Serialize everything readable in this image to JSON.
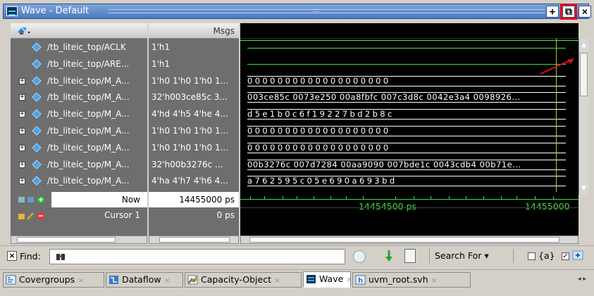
{
  "window": {
    "title": "Wave - Default",
    "buttons": {
      "plus": "+",
      "float": "⧉",
      "close": "×"
    }
  },
  "headers": {
    "msgs": "Msgs"
  },
  "signals": [
    {
      "name": "/tb_liteic_top/ACLK",
      "value": "1'h1",
      "expandable": false,
      "wave_type": "signal",
      "wave": ""
    },
    {
      "name": "/tb_liteic_top/ARE...",
      "value": "1'h1",
      "expandable": false,
      "wave_type": "signal",
      "wave": ""
    },
    {
      "name": "/tb_liteic_top/M_A...",
      "value": "1'h0 1'h0 1'h0 1...",
      "expandable": true,
      "wave_type": "bus-spaced",
      "wave": "0000000000000000000"
    },
    {
      "name": "/tb_liteic_top/M_A...",
      "value": "32'h003ce85c 3...",
      "expandable": true,
      "wave_type": "bus",
      "wave": "003ce85c 0073e250 00a8fbfc 007c3d8c 0042e3a4 0098926..."
    },
    {
      "name": "/tb_liteic_top/M_A...",
      "value": "4'hd 4'h5 4'he 4...",
      "expandable": true,
      "wave_type": "bus-spaced",
      "wave": "d5e1b0c6f19227bd2b8c"
    },
    {
      "name": "/tb_liteic_top/M_A...",
      "value": "1'h0 1'h0 1'h0 1...",
      "expandable": true,
      "wave_type": "bus-spaced",
      "wave": "0000000000000000000"
    },
    {
      "name": "/tb_liteic_top/M_A...",
      "value": "1'h0 1'h0 1'h0 1...",
      "expandable": true,
      "wave_type": "bus-spaced",
      "wave": "0000000000000000000"
    },
    {
      "name": "/tb_liteic_top/M_A...",
      "value": "32'h00b3276c ...",
      "expandable": true,
      "wave_type": "bus",
      "wave": "00b3276c 007d7284 00aa9090 007bde1c 0043cdb4 00b71e..."
    },
    {
      "name": "/tb_liteic_top/M_A...",
      "value": "4'ha 4'h7 4'h6 4...",
      "expandable": true,
      "wave_type": "bus-spaced",
      "wave": "a762595c05e690a693bd"
    }
  ],
  "now_row": {
    "label": "Now",
    "value": "14455000 ps"
  },
  "cursor_row": {
    "label": "Cursor 1",
    "value": "0 ps"
  },
  "timeline": {
    "labels": [
      "14454500 ps",
      "14455000"
    ]
  },
  "findbar": {
    "find_label": "Find:",
    "search_for": "Search For",
    "option_label": "{a}"
  },
  "tabs": [
    {
      "label": "Covergroups",
      "icon": "covergroups-icon",
      "active": false
    },
    {
      "label": "Dataflow",
      "icon": "dataflow-icon",
      "active": false
    },
    {
      "label": "Capacity-Object",
      "icon": "capacity-icon",
      "active": false
    },
    {
      "label": "Wave",
      "icon": "wave-icon",
      "active": true
    },
    {
      "label": "uvm_root.svh",
      "icon": "source-file-icon",
      "active": false
    }
  ],
  "colors": {
    "accent": "#e0101e",
    "wave_green": "#3fe03f",
    "titlebar": "#4b78c0"
  }
}
